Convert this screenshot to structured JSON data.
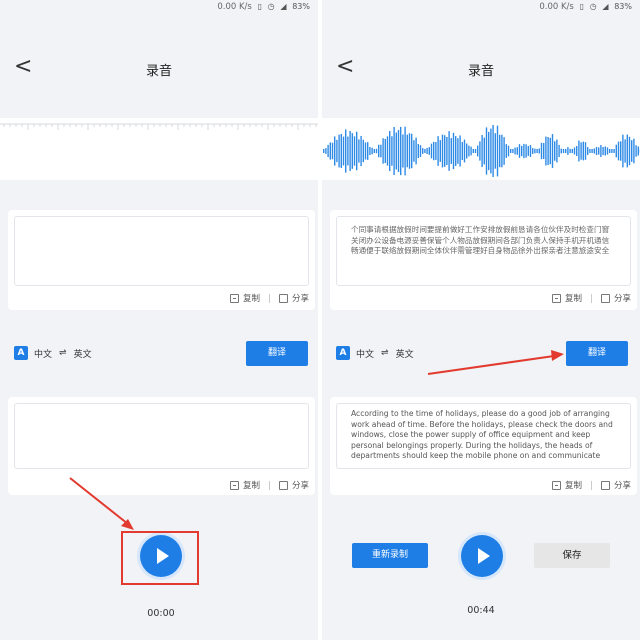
{
  "left": {
    "status": {
      "speed": "0.00 K/s",
      "battery": "83%"
    },
    "header": {
      "back": "<",
      "title": "录音"
    },
    "source_box": {
      "text": ""
    },
    "source_actions": {
      "copy": "复制",
      "share": "分享"
    },
    "lang": {
      "from": "中文",
      "swap": "⇌",
      "to": "英文",
      "translate": "翻译"
    },
    "target_box": {
      "text": ""
    },
    "target_actions": {
      "copy": "复制",
      "share": "分享"
    },
    "timer": "00:00"
  },
  "right": {
    "status": {
      "speed": "0.00 K/s",
      "battery": "83%"
    },
    "header": {
      "back": "<",
      "title": "录音"
    },
    "source_box": {
      "text": "个同事请根据放假时间要提前做好工作安排放假前恳请各位伙伴及时检查门窗关闭办公设备电源妥善保管个人物品放假期间各部门负责人保持手机开机通信畅通便于联络放假期间全体伙伴需管理好自身物品徐外出探亲者注意旅途安全"
    },
    "source_actions": {
      "copy": "复制",
      "share": "分享"
    },
    "lang": {
      "from": "中文",
      "swap": "⇌",
      "to": "英文",
      "translate": "翻译"
    },
    "target_box": {
      "text": "According to the time of holidays, please do a good job of arranging work ahead of time. Before the holidays, please check the doors and windows, close the power supply of office equipment and keep personal belongings properly. During the holidays, the heads of departments should keep the mobile phone on and communicate"
    },
    "target_actions": {
      "copy": "复制",
      "share": "分享"
    },
    "re_record": "重新录制",
    "save": "保存",
    "timer": "00:44"
  },
  "colors": {
    "accent": "#1e7ee6",
    "annotation": "#e23a2e",
    "wave": "#2f8ae6"
  },
  "icons": [
    "back-arrow-icon",
    "translate-icon",
    "swap-icon",
    "copy-icon",
    "share-icon",
    "play-icon",
    "battery-icon",
    "signal-icon",
    "alarm-icon",
    "vibrate-icon"
  ]
}
